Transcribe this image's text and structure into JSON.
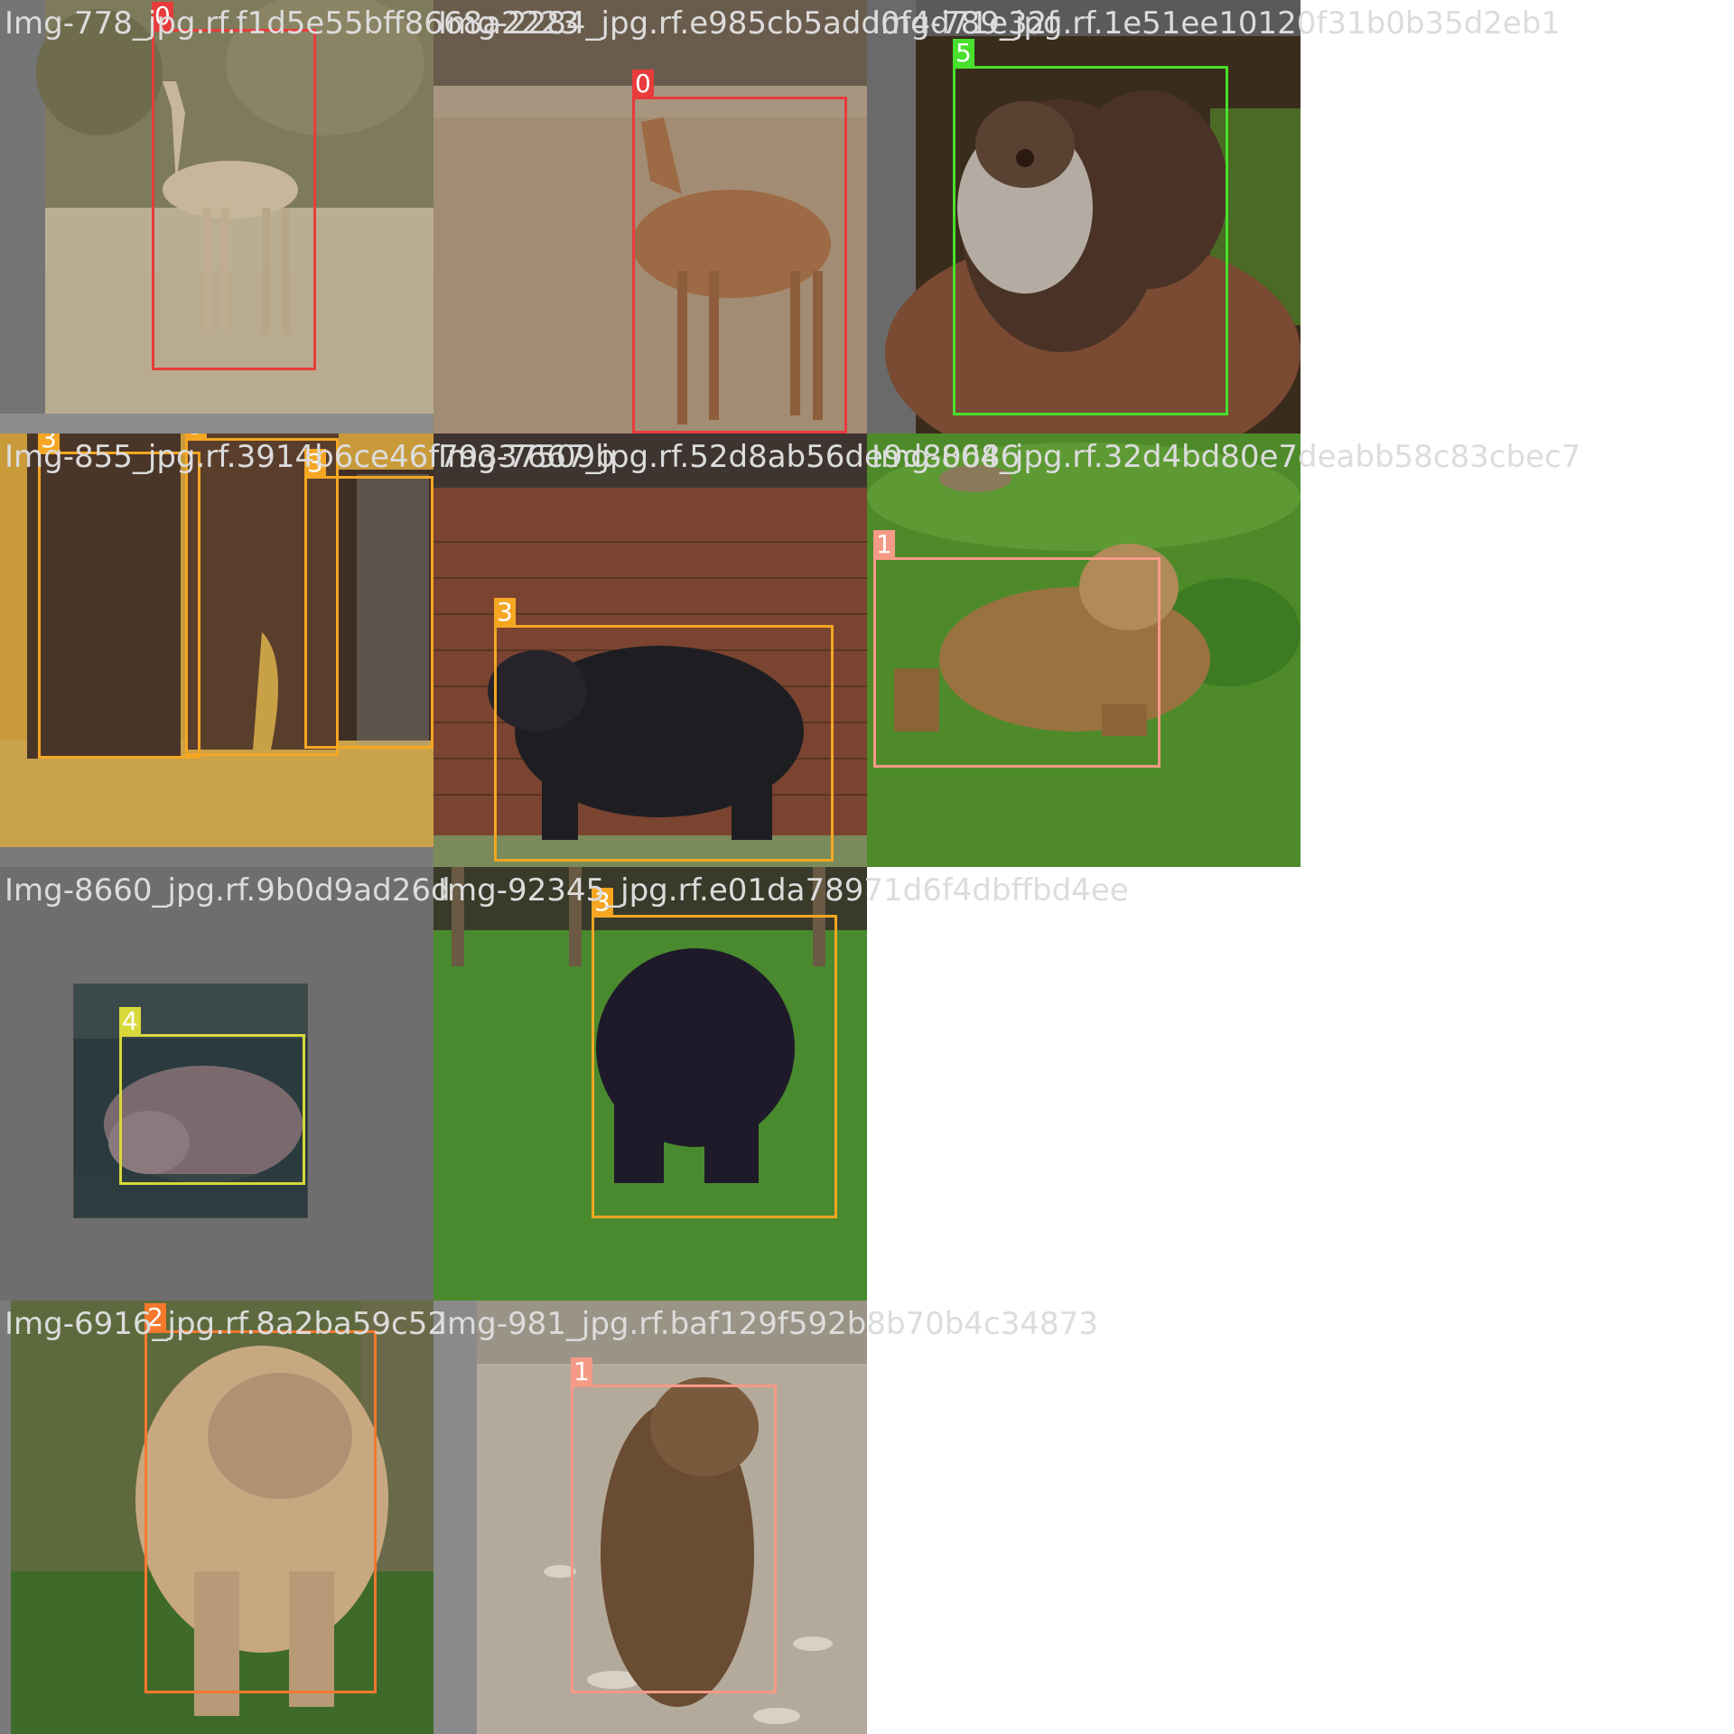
{
  "mosaic": {
    "cells": [
      {
        "filename": "Img-778_jpg.rf.f1d5e55bff8668a2223",
        "scene": "gazelle-dry-scrub",
        "boxes": [
          {
            "class_id": "0",
            "color": "#e83b3b"
          }
        ]
      },
      {
        "filename": "Img-2284_jpg.rf.e985cb5add0f4d71e32f",
        "scene": "hartebeest-dirt",
        "boxes": [
          {
            "class_id": "0",
            "color": "#e83b3b"
          }
        ]
      },
      {
        "filename": "Img-789_jpg.rf.1e51ee10120f31b0b35d2eb1",
        "scene": "otter-on-rock",
        "boxes": [
          {
            "class_id": "5",
            "color": "#48e02c"
          }
        ]
      },
      {
        "filename": "Img-855_jpg.rf.3914b6ce46f79337509b",
        "scene": "chimps-group",
        "boxes": [
          {
            "class_id": "3",
            "color": "#f5a623"
          },
          {
            "class_id": "3",
            "color": "#f5a623"
          },
          {
            "class_id": "3",
            "color": "#f5a623"
          }
        ]
      },
      {
        "filename": "Img-7667_jpg.rf.52d8ab56de9d80686",
        "scene": "chimp-brick-wall",
        "boxes": [
          {
            "class_id": "3",
            "color": "#f5a623"
          }
        ]
      },
      {
        "filename": "Img-804_jpg.rf.32d4bd80e7deabb58c83cbec7",
        "scene": "bear-in-grass",
        "boxes": [
          {
            "class_id": "1",
            "color": "#f59a86"
          }
        ]
      },
      {
        "filename": "Img-8660_jpg.rf.9b0d9ad26d",
        "scene": "hippo-small-photo",
        "boxes": [
          {
            "class_id": "4",
            "color": "#d8d83a"
          }
        ]
      },
      {
        "filename": "Img-92345_jpg.rf.e01da78971d6f4dbffbd4ee",
        "scene": "chimp-walking-grass",
        "boxes": [
          {
            "class_id": "3",
            "color": "#f5a623"
          }
        ]
      },
      {
        "filename": "Img-6916_jpg.rf.8a2ba59c52",
        "scene": "lynx-forest",
        "boxes": [
          {
            "class_id": "2",
            "color": "#f5782c"
          }
        ]
      },
      {
        "filename": "Img-981_jpg.rf.baf129f592b8b70b4c34873",
        "scene": "bear-sitting-gravel",
        "boxes": [
          {
            "class_id": "1",
            "color": "#f59a86"
          }
        ]
      }
    ]
  }
}
